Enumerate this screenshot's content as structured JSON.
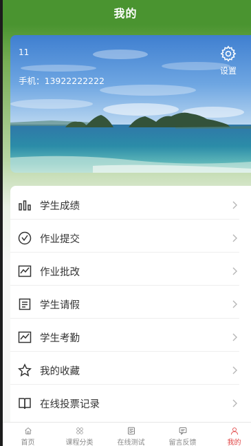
{
  "header": {
    "title": "我的"
  },
  "profile": {
    "name": "11",
    "phone": "手机：13922222222",
    "settings_label": "设置"
  },
  "menu": [
    {
      "label": "学生成绩",
      "icon": "bar-chart-icon"
    },
    {
      "label": "作业提交",
      "icon": "check-circle-icon"
    },
    {
      "label": "作业批改",
      "icon": "line-chart-icon"
    },
    {
      "label": "学生请假",
      "icon": "document-list-icon"
    },
    {
      "label": "学生考勤",
      "icon": "line-chart-icon"
    },
    {
      "label": "我的收藏",
      "icon": "star-icon"
    },
    {
      "label": "在线投票记录",
      "icon": "book-icon"
    }
  ],
  "tabbar": {
    "active_color": "#e04444",
    "items": [
      {
        "label": "首页",
        "icon": "home-icon"
      },
      {
        "label": "课程分类",
        "icon": "grid-icon"
      },
      {
        "label": "在线测试",
        "icon": "exam-paper-icon"
      },
      {
        "label": "留言反馈",
        "icon": "chat-icon"
      },
      {
        "label": "我的",
        "icon": "user-icon",
        "active": true
      }
    ]
  }
}
